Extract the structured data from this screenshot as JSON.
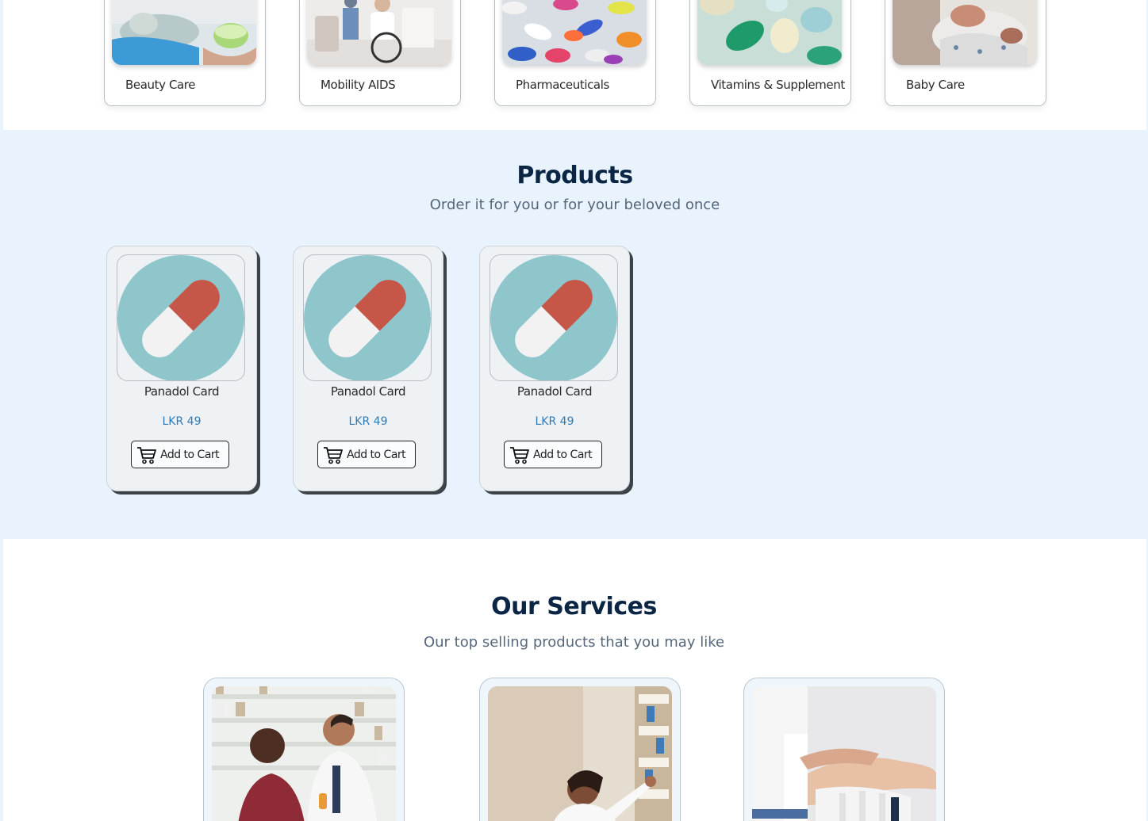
{
  "categories": [
    {
      "label": "Beauty Care",
      "image": "facial-mask-photo"
    },
    {
      "label": "Mobility AIDS",
      "image": "wheelchair-photo"
    },
    {
      "label": "Pharmaceuticals",
      "image": "pills-photo"
    },
    {
      "label": "Vitamins & Supplement",
      "image": "softgel-capsules-photo"
    },
    {
      "label": "Baby Care",
      "image": "newborn-photo"
    }
  ],
  "products_section": {
    "title": "Products",
    "subtitle": "Order it for you or for your beloved once",
    "items": [
      {
        "name": "Panadol Card",
        "price": "LKR 49",
        "button": "Add to Cart",
        "icon": "capsule-icon"
      },
      {
        "name": "Panadol Card",
        "price": "LKR 49",
        "button": "Add to Cart",
        "icon": "capsule-icon"
      },
      {
        "name": "Panadol Card",
        "price": "LKR 49",
        "button": "Add to Cart",
        "icon": "capsule-icon"
      }
    ]
  },
  "services_section": {
    "title": "Our Services",
    "subtitle": "Our top selling products that you may like",
    "items": [
      {
        "image": "pharmacist-consultation-photo"
      },
      {
        "image": "pharmacist-shelf-photo"
      },
      {
        "image": "wrist-splint-photo"
      }
    ]
  },
  "colors": {
    "heading": "#0b2545",
    "subtitle": "#56677a",
    "price": "#2f79b5",
    "section_bg": "#e8f3fd",
    "capsule_bg": "#8ec6cc",
    "capsule_red": "#c65648",
    "capsule_white": "#f2f2f2"
  }
}
